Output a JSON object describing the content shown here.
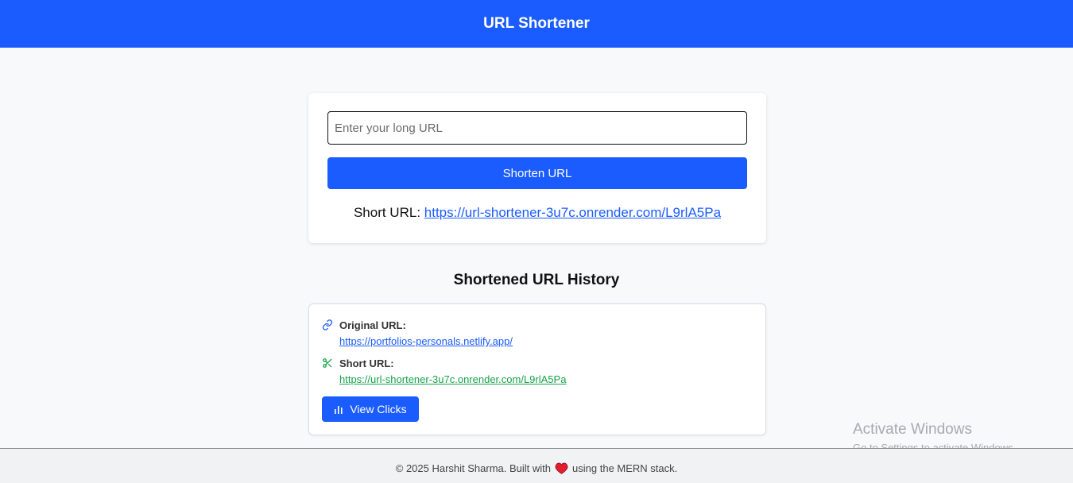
{
  "header": {
    "title": "URL Shortener"
  },
  "form": {
    "input_value": "",
    "input_placeholder": "Enter your long URL",
    "button_label": "Shorten URL",
    "result_label": "Short URL:",
    "result_url": "https://url-shortener-3u7c.onrender.com/L9rlA5Pa"
  },
  "history": {
    "title": "Shortened URL History",
    "items": [
      {
        "original_label": "Original URL:",
        "original_url": "https://portfolios-personals.netlify.app/",
        "short_label": "Short URL:",
        "short_url": "https://url-shortener-3u7c.onrender.com/L9rlA5Pa",
        "clicks_button_label": "View Clicks",
        "original_icon": "link-icon",
        "short_icon": "scissors-icon",
        "clicks_icon": "bar-chart-icon"
      }
    ]
  },
  "watermark": {
    "line1": "Activate Windows",
    "line2": "Go to Settings to activate Windows."
  },
  "footer": {
    "text_before": "© 2025 Harshit Sharma. Built with",
    "text_after": "using the MERN stack.",
    "heart_icon": "heart-icon"
  },
  "colors": {
    "primary": "#1a5cff",
    "success": "#16a34a",
    "heart": "#e11d2e"
  }
}
